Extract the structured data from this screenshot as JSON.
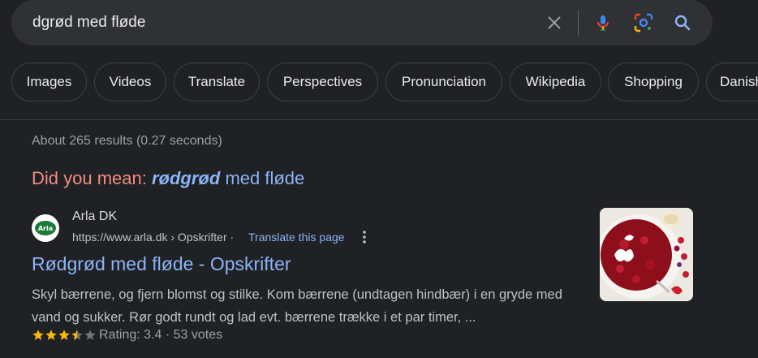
{
  "search": {
    "query": "dgrød med fløde"
  },
  "chips": [
    {
      "label": "Images"
    },
    {
      "label": "Videos"
    },
    {
      "label": "Translate"
    },
    {
      "label": "Perspectives"
    },
    {
      "label": "Pronunciation"
    },
    {
      "label": "Wikipedia"
    },
    {
      "label": "Shopping"
    },
    {
      "label": "Danish"
    }
  ],
  "stats": "About 265 results (0.27 seconds)",
  "did_you_mean": {
    "label": "Did you mean:",
    "corrected_bold": "rødgrød",
    "corrected_rest": "med fløde"
  },
  "result": {
    "site_name": "Arla DK",
    "favicon_text": "Arla",
    "url": "https://www.arla.dk › Opskrifter",
    "url_separator": "·",
    "translate_label": "Translate this page",
    "title": "Rødgrød med fløde - Opskrifter",
    "snippet": "Skyl bærrene, og fjern blomst og stilke. Kom bærrene (undtagen hindbær) i en gryde med vand og sukker. Rør godt rundt og lad evt. bærrene trække i et par timer, ...",
    "rating_text": "Rating: 3.4",
    "rating_value": 3.4,
    "rating_max": 5,
    "votes_text": "53 votes",
    "meta_separator": "·"
  },
  "colors": {
    "background": "#202124",
    "link": "#8ab4f8",
    "did_you_mean": "#f28b82",
    "star": "#fbbc04"
  }
}
